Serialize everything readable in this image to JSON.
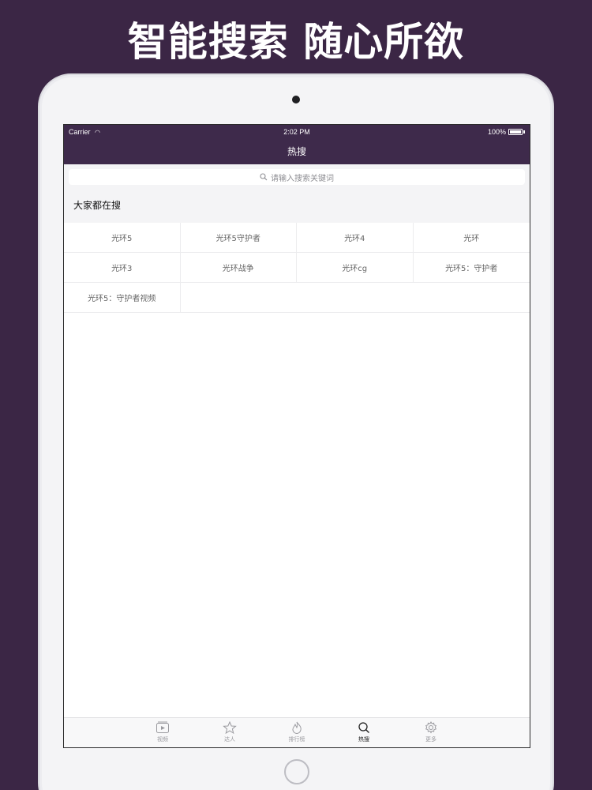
{
  "banner": {
    "title": "智能搜索 随心所欲"
  },
  "status_bar": {
    "carrier": "Carrier",
    "time": "2:02 PM",
    "battery": "100%"
  },
  "nav": {
    "title": "热搜"
  },
  "search": {
    "placeholder": "请输入搜索关键词"
  },
  "section": {
    "title": "大家都在搜"
  },
  "hot_terms": [
    "光环5",
    "光环5守护者",
    "光环4",
    "光环",
    "光环3",
    "光环战争",
    "光环cg",
    "光环5：守护者",
    "光环5：守护者视频"
  ],
  "tabbar": {
    "items": [
      {
        "label": "视频",
        "icon": "video-icon"
      },
      {
        "label": "达人",
        "icon": "star-icon"
      },
      {
        "label": "排行榜",
        "icon": "flame-icon"
      },
      {
        "label": "热搜",
        "icon": "search-icon",
        "active": true
      },
      {
        "label": "更多",
        "icon": "gear-icon"
      }
    ]
  },
  "colors": {
    "background": "#3b2645",
    "navbar": "#3e2a4b",
    "active_tab": "#222222",
    "inactive_tab": "#9a9a9f"
  }
}
